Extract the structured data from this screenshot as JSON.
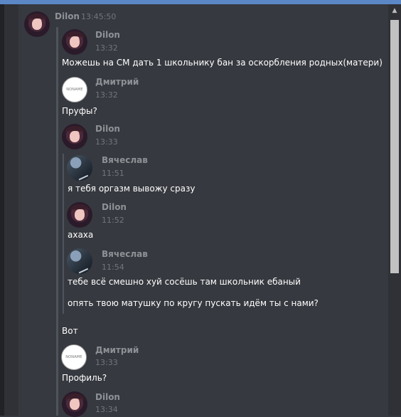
{
  "header": {
    "author": "Dilon",
    "time": "13:45:50"
  },
  "quote": {
    "m1": {
      "author": "Dilon",
      "time": "13:32",
      "text": "Можешь на СМ дать 1 школьнику бан за оскорбления родных(матери)"
    },
    "m2": {
      "author": "Дмитрий",
      "time": "13:32",
      "text": "Пруфы?",
      "avatar_label": "NONAME"
    },
    "m3": {
      "author": "Dilon",
      "time": "13:33",
      "nested": [
        {
          "author": "Вячеслав",
          "time": "11:51",
          "text": "я тебя оргазм вывожу сразу"
        },
        {
          "author": "Dilon",
          "time": "11:52",
          "text": "ахаха"
        },
        {
          "author": "Вячеслав",
          "time": "11:54",
          "text": "тебе всё смешно хуй сосёшь там школьник ебаный",
          "text2": "опять твою матушку по кругу пускать идём ты с нами?"
        }
      ],
      "caption": "Вот"
    },
    "m4": {
      "author": "Дмитрий",
      "time": "13:33",
      "text": "Профиль?",
      "avatar_label": "NONAME"
    },
    "m5": {
      "author": "Dilon",
      "time": "13:34"
    }
  },
  "scrollbar": {
    "up_glyph": "▲"
  }
}
